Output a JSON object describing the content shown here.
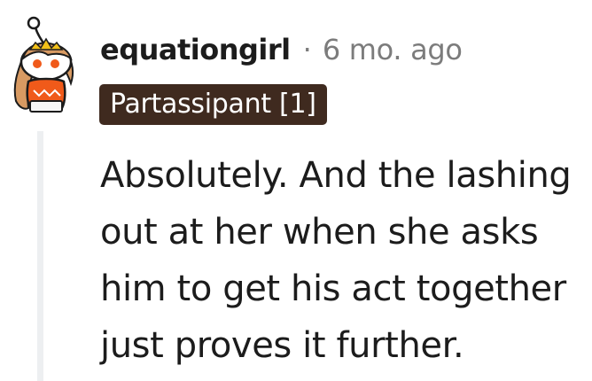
{
  "comment": {
    "username": "equationgirl",
    "separator": "·",
    "timestamp": "6 mo. ago",
    "flair": "Partassipant [1]",
    "body": "Absolutely. And the lashing out at her when she asks him to get his act together just proves it further.",
    "avatar_icon": "snoo-avatar-icon"
  },
  "colors": {
    "username": "#1c1c1c",
    "meta_gray": "#7c7c7c",
    "flair_bg": "#3f2a1f",
    "flair_text": "#ffffff",
    "thread_line": "#edeff1",
    "avatar_orange": "#f05a1a"
  }
}
